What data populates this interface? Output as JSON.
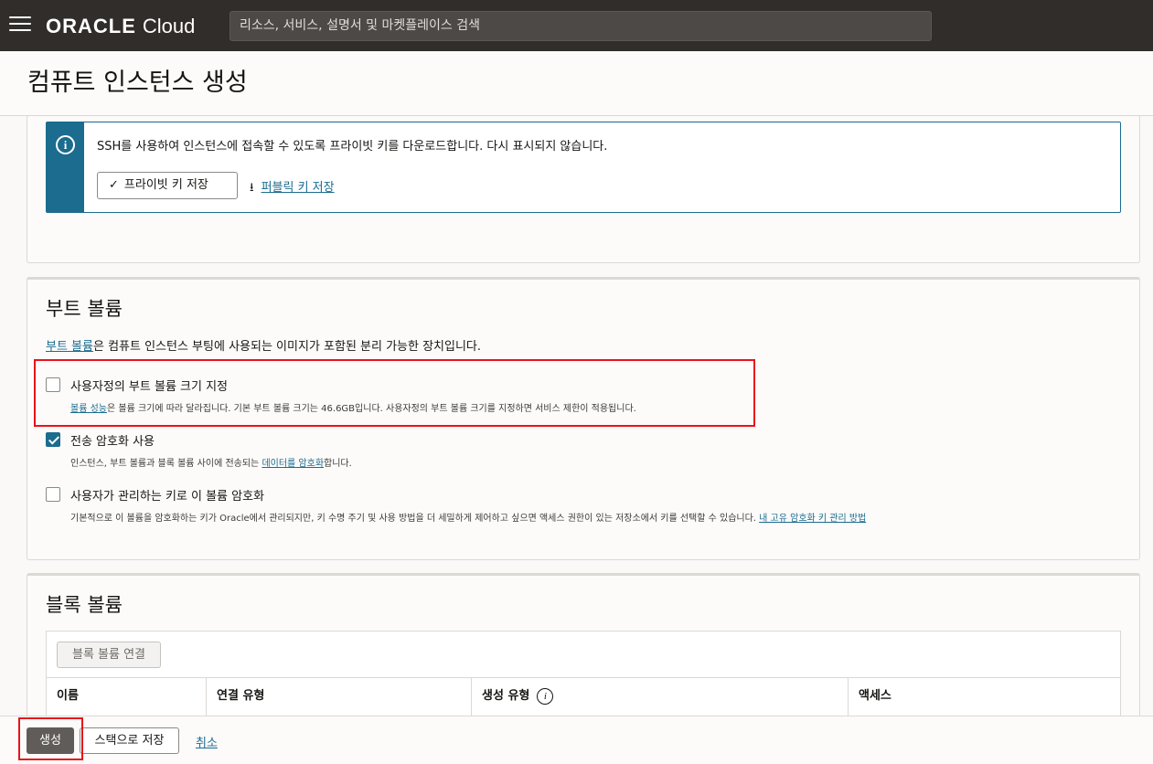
{
  "header": {
    "menu_icon": "hamburger-menu-icon",
    "logo_brand": "ORACLE",
    "logo_product": "Cloud",
    "search_placeholder": "리소스, 서비스, 설명서 및 마켓플레이스 검색"
  },
  "page": {
    "title": "컴퓨트 인스턴스 생성"
  },
  "ssh_notice": {
    "icon": "info-icon",
    "message": "SSH를 사용하여 인스턴스에 접속할 수 있도록 프라이빗 키를 다운로드합니다. 다시 표시되지 않습니다.",
    "save_private_key_label": "프라이빗 키 저장",
    "save_public_key_label": "퍼블릭 키 저장"
  },
  "boot_volume": {
    "title": "부트 볼륨",
    "desc_link": "부트 볼륨",
    "desc_rest": "은 컴퓨트 인스턴스 부팅에 사용되는 이미지가 포함된 분리 가능한 장치입니다.",
    "options": [
      {
        "label": "사용자정의 부트 볼륨 크기 지정",
        "checked": false,
        "help_link": "볼륨 성능",
        "help_rest": "은 볼륨 크기에 따라 달라집니다. 기본 부트 볼륨 크기는 46.6GB입니다. 사용자정의 부트 볼륨 크기를 지정하면 서비스 제한이 적용됩니다."
      },
      {
        "label": "전송 암호화 사용",
        "checked": true,
        "help_pre": "인스턴스, 부트 볼륨과 블록 볼륨 사이에 전송되는 ",
        "help_link": "데이터를 암호화",
        "help_post": "합니다."
      },
      {
        "label": "사용자가 관리하는 키로 이 볼륨 암호화",
        "checked": false,
        "help_pre": "기본적으로 이 볼륨을 암호화하는 키가 Oracle에서 관리되지만, 키 수명 주기 및 사용 방법을 더 세밀하게 제어하고 싶으면 액세스 권한이 있는 저장소에서 키를 선택할 수 있습니다. ",
        "help_link": "내 고유 암호화 키 관리 방법"
      }
    ]
  },
  "block_volume": {
    "title": "블록 볼륨",
    "attach_button": "블록 볼륨 연결",
    "columns": [
      "이름",
      "연결 유형",
      "생성 유형",
      "액세스"
    ]
  },
  "footer": {
    "create_label": "생성",
    "save_stack_label": "스택으로 저장",
    "cancel_label": "취소"
  },
  "colors": {
    "accent": "#1b6c8f",
    "topbar": "#312d2a",
    "highlight": "#e8131b"
  }
}
